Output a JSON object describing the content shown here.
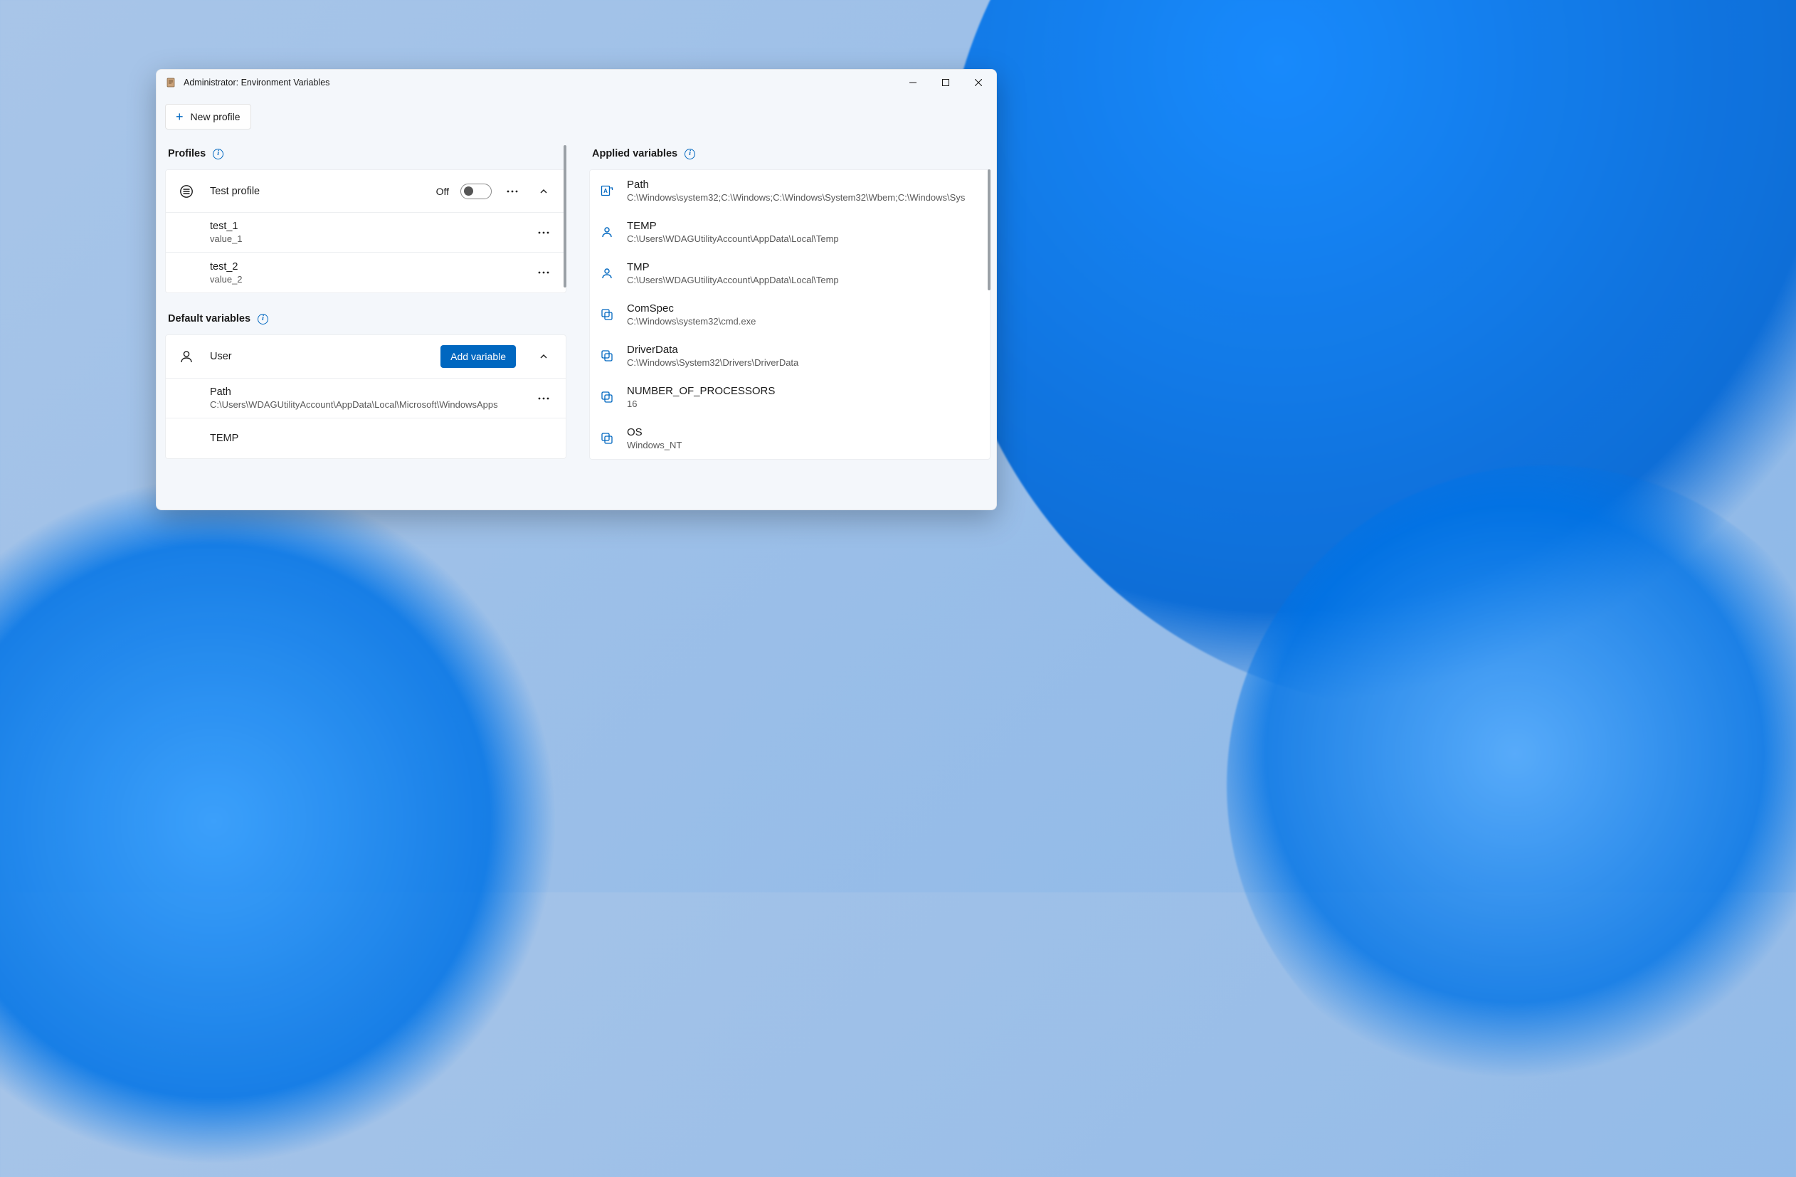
{
  "window": {
    "title": "Administrator: Environment Variables"
  },
  "toolbar": {
    "new_profile_label": "New profile"
  },
  "sections": {
    "profiles_label": "Profiles",
    "default_vars_label": "Default variables",
    "applied_vars_label": "Applied variables"
  },
  "profile": {
    "name": "Test profile",
    "toggle_state_label": "Off",
    "toggle_on": false,
    "variables": [
      {
        "name": "test_1",
        "value": "value_1"
      },
      {
        "name": "test_2",
        "value": "value_2"
      }
    ]
  },
  "default_vars": {
    "user_label": "User",
    "add_variable_label": "Add variable",
    "user_variables": [
      {
        "name": "Path",
        "value": "C:\\Users\\WDAGUtilityAccount\\AppData\\Local\\Microsoft\\WindowsApps"
      },
      {
        "name": "TEMP",
        "value": ""
      }
    ]
  },
  "applied_vars": [
    {
      "type": "applied",
      "name": "Path",
      "value": "C:\\Windows\\system32;C:\\Windows;C:\\Windows\\System32\\Wbem;C:\\Windows\\Sys"
    },
    {
      "type": "user",
      "name": "TEMP",
      "value": "C:\\Users\\WDAGUtilityAccount\\AppData\\Local\\Temp"
    },
    {
      "type": "user",
      "name": "TMP",
      "value": "C:\\Users\\WDAGUtilityAccount\\AppData\\Local\\Temp"
    },
    {
      "type": "system",
      "name": "ComSpec",
      "value": "C:\\Windows\\system32\\cmd.exe"
    },
    {
      "type": "system",
      "name": "DriverData",
      "value": "C:\\Windows\\System32\\Drivers\\DriverData"
    },
    {
      "type": "system",
      "name": "NUMBER_OF_PROCESSORS",
      "value": "16"
    },
    {
      "type": "system",
      "name": "OS",
      "value": "Windows_NT"
    }
  ]
}
